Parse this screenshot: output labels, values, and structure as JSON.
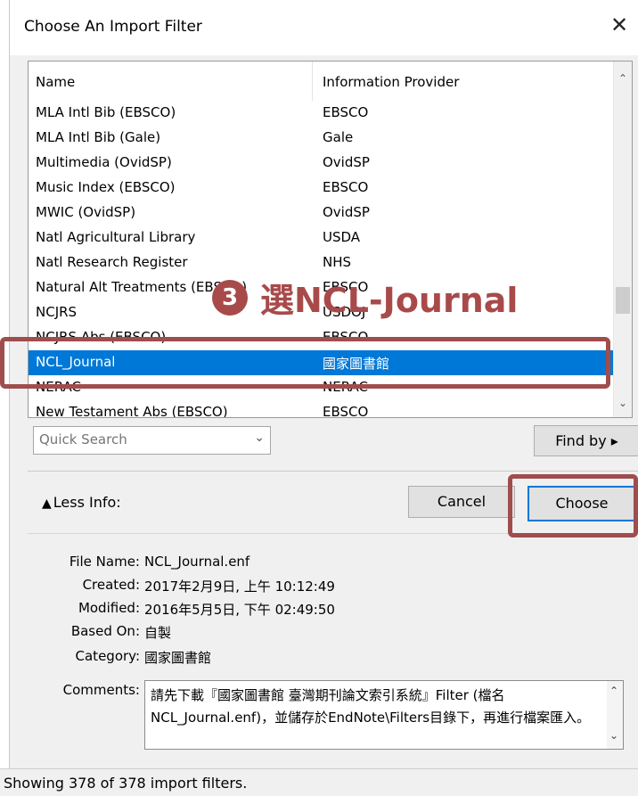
{
  "window": {
    "title": "Choose An Import Filter",
    "close_symbol": "✕"
  },
  "list": {
    "columns": [
      "Name",
      "Information Provider"
    ],
    "rows": [
      {
        "name": "MLA Intl Bib (EBSCO)",
        "provider": "EBSCO"
      },
      {
        "name": "MLA Intl Bib (Gale)",
        "provider": "Gale"
      },
      {
        "name": "Multimedia (OvidSP)",
        "provider": "OvidSP"
      },
      {
        "name": "Music Index (EBSCO)",
        "provider": "EBSCO"
      },
      {
        "name": "MWIC (OvidSP)",
        "provider": "OvidSP"
      },
      {
        "name": "Natl Agricultural Library",
        "provider": "USDA"
      },
      {
        "name": "Natl Research Register",
        "provider": "NHS"
      },
      {
        "name": "Natural Alt Treatments (EBSCO)",
        "provider": "EBSCO"
      },
      {
        "name": "NCJRS",
        "provider": "USDOJ"
      },
      {
        "name": "NCJRS Abs (EBSCO)",
        "provider": "EBSCO"
      },
      {
        "name": "NCL_Journal",
        "provider": "國家圖書館"
      },
      {
        "name": "NERAC",
        "provider": "NERAC"
      },
      {
        "name": "New Testament Abs (EBSCO)",
        "provider": "EBSCO"
      }
    ],
    "selected_index": 10
  },
  "annotation": {
    "step_number": "3",
    "text": "選NCL-Journal"
  },
  "search": {
    "placeholder": "Quick Search",
    "find_by_label": "Find by ▸"
  },
  "buttons": {
    "less_info": "Less Info:",
    "cancel": "Cancel",
    "choose": "Choose"
  },
  "info": {
    "file_name_label": "File Name:",
    "file_name": "NCL_Journal.enf",
    "created_label": "Created:",
    "created": "2017年2月9日, 上午 10:12:49",
    "modified_label": "Modified:",
    "modified": "2016年5月5日, 下午 02:49:50",
    "based_on_label": "Based On:",
    "based_on": "自製",
    "category_label": "Category:",
    "category": "國家圖書館",
    "comments_label": "Comments:",
    "comments": "請先下載『國家圖書館 臺灣期刊論文索引系統』Filter (檔名NCL_Journal.enf)，並儲存於EndNote\\Filters目錄下，再進行檔案匯入。"
  },
  "status": {
    "text": "Showing 378 of 378 import filters."
  },
  "colors": {
    "selection": "#0078d7",
    "annotation": "#a84a4a"
  }
}
